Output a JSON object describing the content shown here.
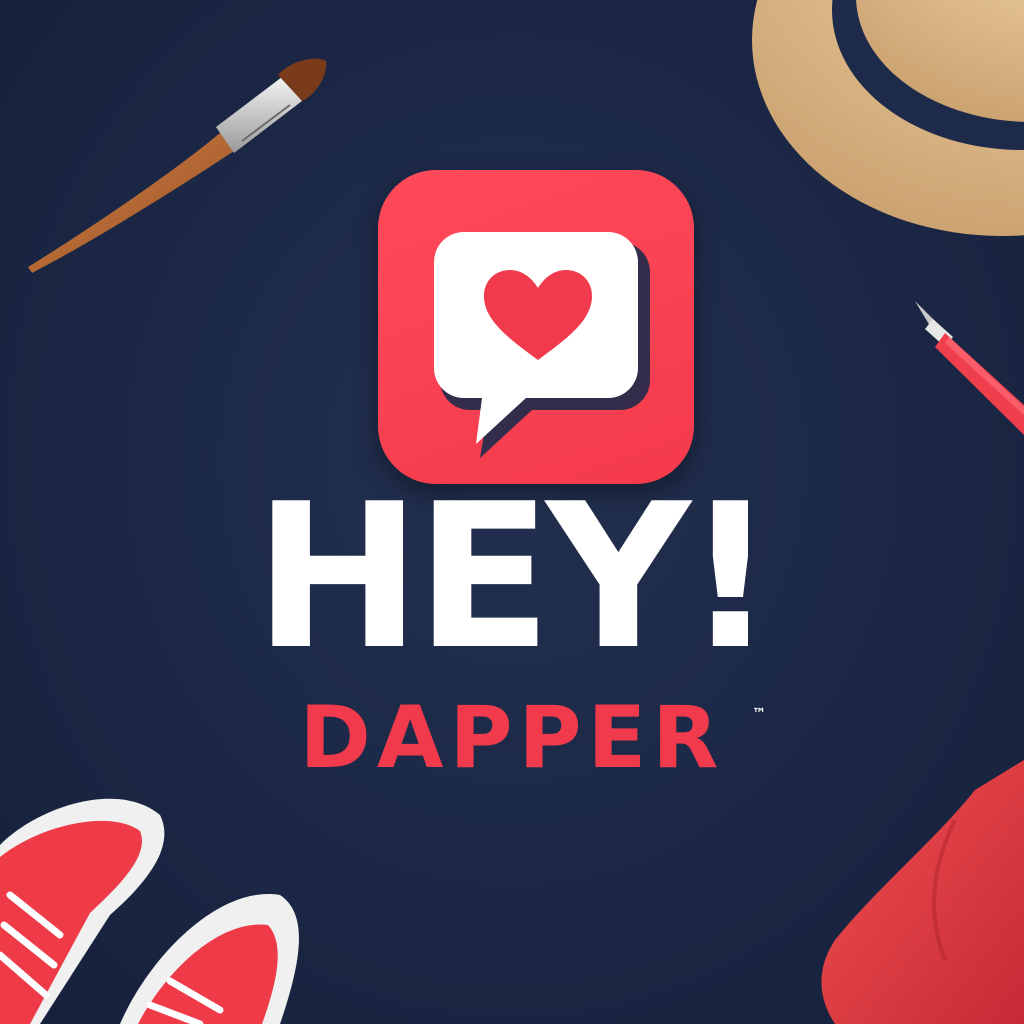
{
  "brand": {
    "headline": "HEY!",
    "name": "DAPPER",
    "trademark": "™"
  },
  "colors": {
    "background": "#1b2745",
    "accent": "#f23a4d",
    "icon_background": "#f5404f",
    "bubble": "#ffffff",
    "heart": "#f23a4d"
  },
  "icons": {
    "app_icon": "chat-bubble-heart-icon",
    "decor": [
      "paintbrush-icon",
      "straw-hat-icon",
      "pen-icon",
      "sneakers-icon",
      "folded-shirt-icon"
    ]
  }
}
